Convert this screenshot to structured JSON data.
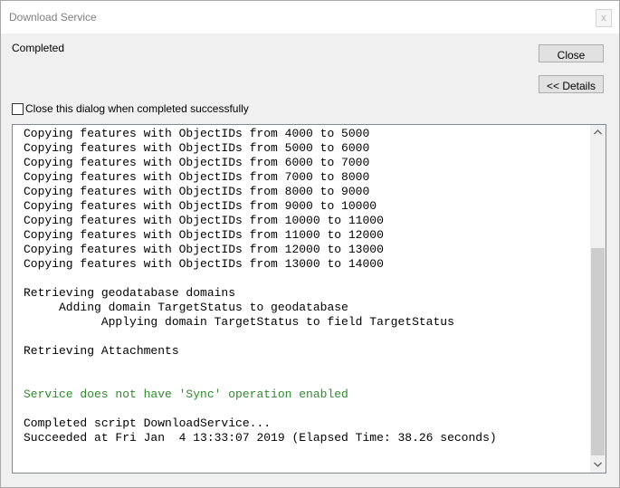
{
  "window": {
    "title": "Download Service",
    "close_glyph": "x"
  },
  "status": {
    "text": "Completed"
  },
  "buttons": {
    "close_label": "Close",
    "details_label": "<< Details"
  },
  "options": {
    "close_on_success_label": "Close this dialog when completed successfully",
    "close_on_success_checked": false
  },
  "log": {
    "lines": [
      {
        "text": "Copying features with ObjectIDs from 4000 to 5000",
        "color": "#000000"
      },
      {
        "text": "Copying features with ObjectIDs from 5000 to 6000",
        "color": "#000000"
      },
      {
        "text": "Copying features with ObjectIDs from 6000 to 7000",
        "color": "#000000"
      },
      {
        "text": "Copying features with ObjectIDs from 7000 to 8000",
        "color": "#000000"
      },
      {
        "text": "Copying features with ObjectIDs from 8000 to 9000",
        "color": "#000000"
      },
      {
        "text": "Copying features with ObjectIDs from 9000 to 10000",
        "color": "#000000"
      },
      {
        "text": "Copying features with ObjectIDs from 10000 to 11000",
        "color": "#000000"
      },
      {
        "text": "Copying features with ObjectIDs from 11000 to 12000",
        "color": "#000000"
      },
      {
        "text": "Copying features with ObjectIDs from 12000 to 13000",
        "color": "#000000"
      },
      {
        "text": "Copying features with ObjectIDs from 13000 to 14000",
        "color": "#000000"
      },
      {
        "text": "",
        "color": "#000000"
      },
      {
        "text": "Retrieving geodatabase domains",
        "color": "#000000"
      },
      {
        "text": "     Adding domain TargetStatus to geodatabase",
        "color": "#000000"
      },
      {
        "text": "           Applying domain TargetStatus to field TargetStatus",
        "color": "#000000"
      },
      {
        "text": "",
        "color": "#000000"
      },
      {
        "text": "Retrieving Attachments",
        "color": "#000000"
      },
      {
        "text": "",
        "color": "#000000"
      },
      {
        "text": "",
        "color": "#000000"
      },
      {
        "text": "Service does not have 'Sync' operation enabled",
        "color": "#2e8b2e"
      },
      {
        "text": "",
        "color": "#000000"
      },
      {
        "text": "Completed script DownloadService...",
        "color": "#000000"
      },
      {
        "text": "Succeeded at Fri Jan  4 13:33:07 2019 (Elapsed Time: 38.26 seconds)",
        "color": "#000000"
      }
    ]
  },
  "scrollbar": {
    "up_icon": "scroll-up-arrow",
    "down_icon": "scroll-down-arrow"
  }
}
